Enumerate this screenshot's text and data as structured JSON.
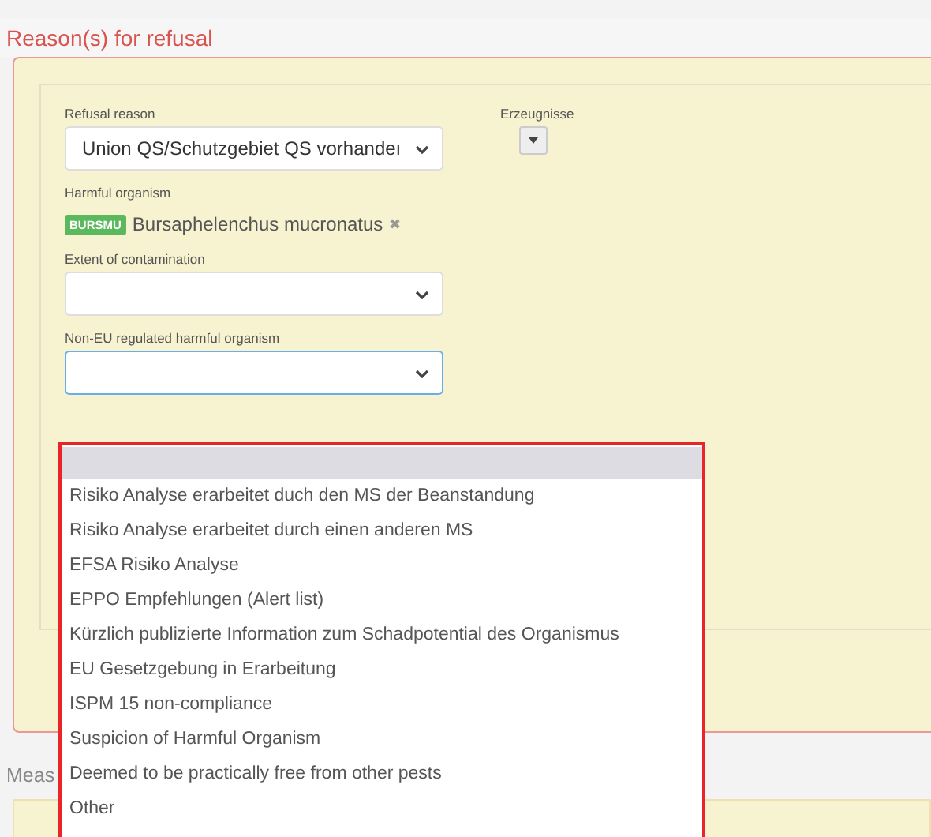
{
  "section_title": "Reason(s) for refusal",
  "fields": {
    "refusal_reason": {
      "label": "Refusal reason",
      "value": "Union QS/Schutzgebiet QS vorhandeı"
    },
    "products": {
      "label": "Erzeugnisse"
    },
    "harmful_organism": {
      "label": "Harmful organism",
      "code": "BURSMU",
      "name": "Bursaphelenchus mucronatus",
      "remove": "✖"
    },
    "extent": {
      "label": "Extent of contamination"
    },
    "non_eu": {
      "label": "Non-EU regulated harmful organism",
      "focused": true
    }
  },
  "dropdown": {
    "blank_highlighted": true,
    "options": [
      {
        "label": "Risiko Analyse erarbeitet duch den MS der Beanstandung",
        "selected": false
      },
      {
        "label": "Risiko Analyse erarbeitet durch einen anderen MS",
        "selected": false
      },
      {
        "label": "EFSA Risiko Analyse",
        "selected": false
      },
      {
        "label": "EPPO Empfehlungen (Alert list)",
        "selected": false
      },
      {
        "label": "Kürzlich publizierte Information zum Schadpotential des Organismus",
        "selected": false
      },
      {
        "label": "EU Gesetzgebung in Erarbeitung",
        "selected": false
      },
      {
        "label": "ISPM 15 non-compliance",
        "selected": false
      },
      {
        "label": "Suspicion of Harmful Organism",
        "selected": false
      },
      {
        "label": "Deemed to be practically free from other pests",
        "selected": false
      },
      {
        "label": "Other",
        "selected": false
      }
    ]
  },
  "next_section_title": "Meas"
}
